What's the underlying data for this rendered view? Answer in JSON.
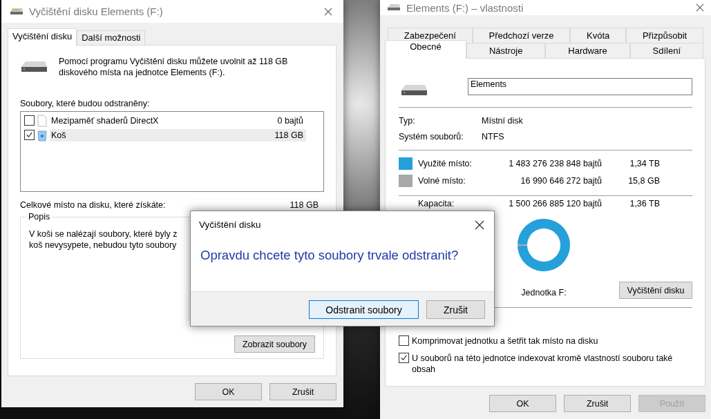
{
  "cleanup_window": {
    "title": "Vyčištění disku Elements (F:)",
    "tabs": [
      {
        "label": "Vyčištění disku",
        "selected": true
      },
      {
        "label": "Další možnosti",
        "selected": false
      }
    ],
    "intro": "Pomocí programu Vyčištění disku můžete uvolnit až 118 GB diskového místa na jednotce Elements (F:).",
    "files_label": "Soubory, které budou odstraněny:",
    "files": [
      {
        "kind": "file",
        "name": "Mezipaměť shaderů DirectX",
        "size": "0 bajtů",
        "checked": false,
        "selected": false
      },
      {
        "kind": "recycle",
        "name": "Koš",
        "size": "118 GB",
        "checked": true,
        "selected": true
      }
    ],
    "total_label": "Celkové místo na disku, které získáte:",
    "total_value": "118 GB",
    "description": {
      "title": "Popis",
      "lines": [
        "V koši se nalézají soubory, které byly z",
        "koš nevysypete, nebudou tyto soubory"
      ]
    },
    "view_files_button": "Zobrazit soubory",
    "buttons": [
      "OK",
      "Zrušit"
    ]
  },
  "properties_window": {
    "title": "Elements (F:) – vlastnosti",
    "tab_rows": [
      {
        "tabs": [
          {
            "label": "Zabezpečení",
            "selected": false
          },
          {
            "label": "Předchozí verze",
            "selected": false
          },
          {
            "label": "Kvóta",
            "selected": false
          },
          {
            "label": "Přizpůsobit",
            "selected": false
          }
        ]
      },
      {
        "tabs": [
          {
            "label": "Obecné",
            "selected": true
          },
          {
            "label": "Nástroje",
            "selected": false
          },
          {
            "label": "Hardware",
            "selected": false
          },
          {
            "label": "Sdílení",
            "selected": false
          }
        ]
      }
    ],
    "name_value": "Elements",
    "info": [
      {
        "label": "Typ:",
        "value": "Místní disk"
      },
      {
        "label": "Systém souborů:",
        "value": "NTFS"
      }
    ],
    "usage": [
      {
        "label": "Využité místo:",
        "bytes": "1 483 276 238 848 bajtů",
        "size": "1,34 TB",
        "color": "#26a0da"
      },
      {
        "label": "Volné místo:",
        "bytes": "16 990 646 272 bajtů",
        "size": "15,8 GB",
        "color": "#a8a8a8"
      }
    ],
    "capacity": {
      "label": "Kapacita:",
      "bytes": "1 500 266 885 120 bajtů",
      "size": "1,36 TB"
    },
    "drive_label": "Jednotka F:",
    "cleanup_button": "Vyčištění disku",
    "options": [
      {
        "label": "Komprimovat jednotku a šetřit tak místo na disku",
        "checked": false
      },
      {
        "label": "U souborů na této jednotce indexovat kromě vlastností souboru také obsah",
        "checked": true
      }
    ],
    "buttons": [
      {
        "label": "OK",
        "disabled": false
      },
      {
        "label": "Zrušit",
        "disabled": false
      },
      {
        "label": "Použít",
        "disabled": true
      }
    ]
  },
  "confirm_dialog": {
    "title": "Vyčištění disku",
    "message": "Opravdu chcete tyto soubory trvale odstranit?",
    "buttons": [
      {
        "label": "Odstranit soubory",
        "default": true
      },
      {
        "label": "Zrušit",
        "default": false
      }
    ]
  }
}
